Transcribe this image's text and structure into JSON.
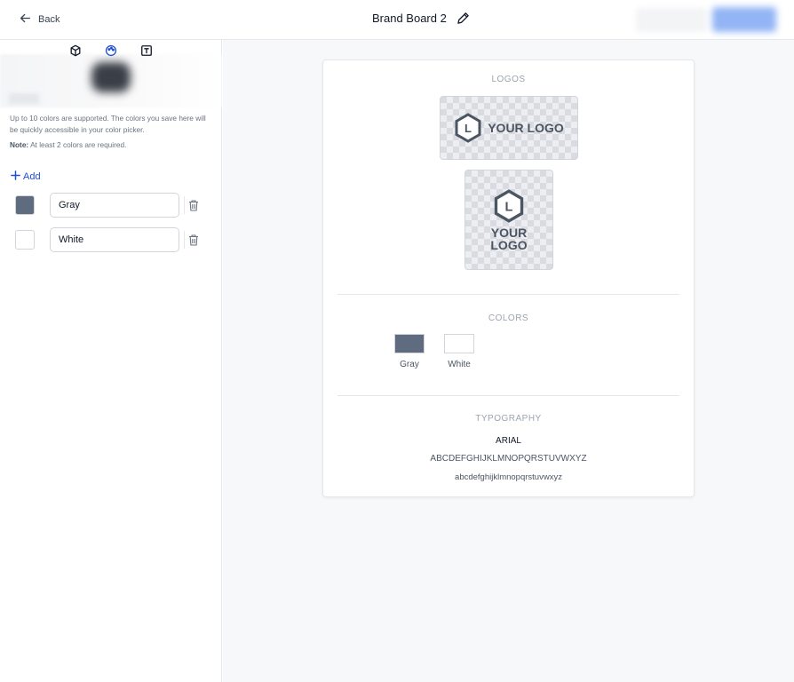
{
  "topbar": {
    "back_label": "Back",
    "title": "Brand Board 2"
  },
  "sidebar": {
    "tabs": [
      "logo-tab",
      "palette-tab",
      "text-tab"
    ],
    "help_text": "Up to 10 colors are supported. The colors you save here will be quickly accessible in your color picker.",
    "note_label": "Note:",
    "note_text": "At least 2 colors are required.",
    "add_label": "Add",
    "colors": [
      {
        "name": "Gray",
        "hex": "#5f6b7f"
      },
      {
        "name": "White",
        "hex": "#ffffff"
      }
    ]
  },
  "board": {
    "logos_title": "LOGOS",
    "logo_mark": "L",
    "logo_text_h": "YOUR LOGO",
    "logo_text_v1": "YOUR",
    "logo_text_v2": "LOGO",
    "colors_title": "COLORS",
    "palette": [
      {
        "name": "Gray",
        "hex": "#5f6b7f"
      },
      {
        "name": "White",
        "hex": "#ffffff"
      }
    ],
    "typography_title": "TYPOGRAPHY",
    "font_name": "ARIAL",
    "uppercase_sample": "ABCDEFGHIJKLMNOPQRSTUVWXYZ",
    "lowercase_sample": "abcdefghijklmnopqrstuvwxyz"
  },
  "colors": {
    "accent": "#1d4ed8",
    "border": "#e5e7eb"
  }
}
